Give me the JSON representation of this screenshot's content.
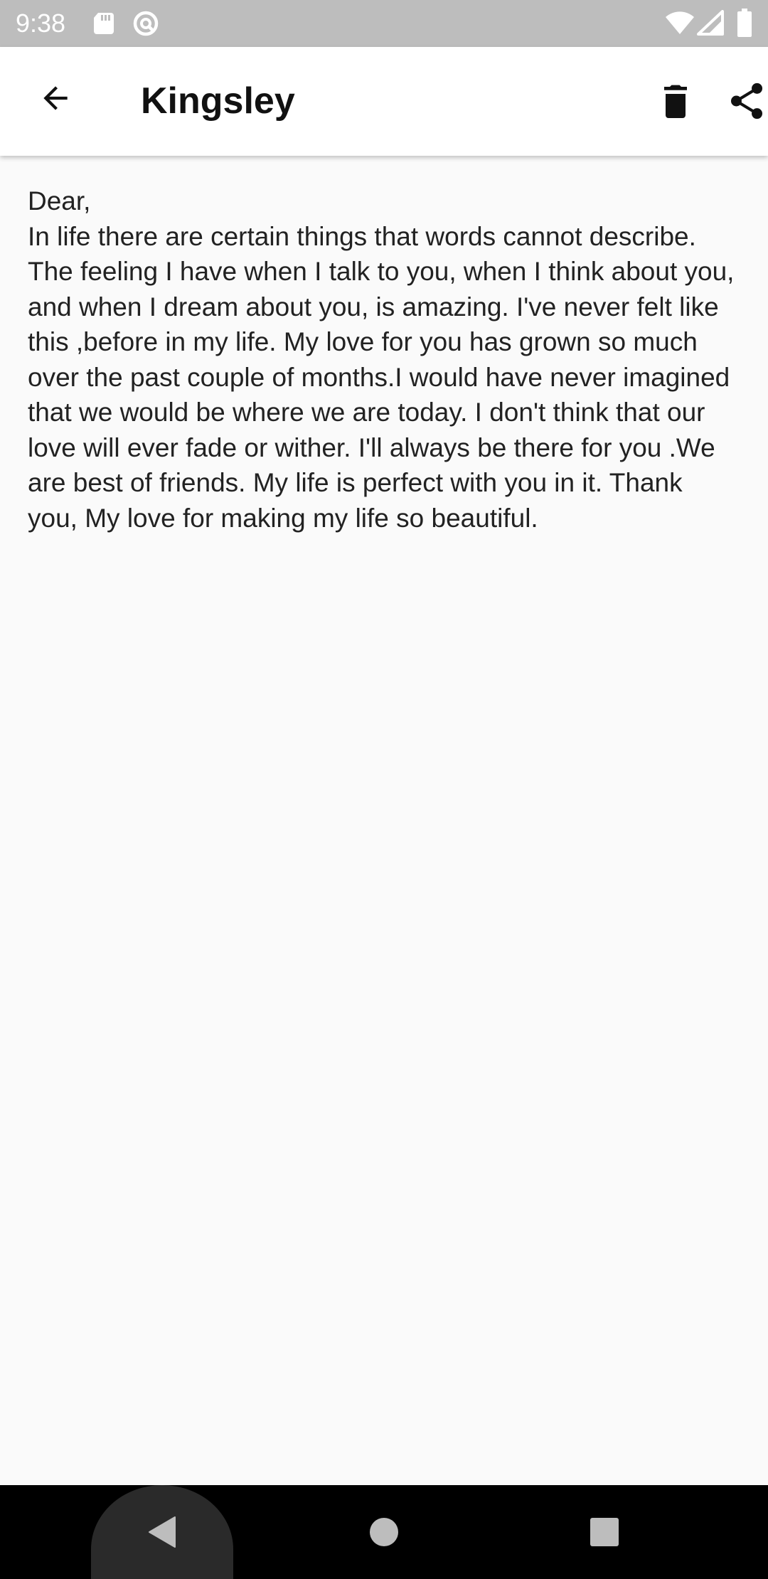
{
  "status_bar": {
    "time": "9:38",
    "icons": [
      "sd-card-icon",
      "sync-icon",
      "wifi-icon",
      "signal-icon",
      "battery-icon"
    ]
  },
  "app_bar": {
    "title": "Kingsley",
    "icons": [
      "back-arrow-icon",
      "trash-icon",
      "share-icon"
    ]
  },
  "note": {
    "greeting": "Dear,",
    "body": "In life there are certain things that words cannot describe. The feeling I have when I talk to you, when I think about you, and when I dream about you, is amazing. I've never felt like this ,before in my life. My love for you has grown so much over the past couple of months.I would have never imagined that we would be where we are today. I don't think that our love will ever fade or wither. I'll always be there for you .We are best of friends. My life is perfect with you in it. Thank you, My love for making my life so beautiful."
  },
  "nav_bar": {
    "icons": [
      "nav-back-icon",
      "nav-home-icon",
      "nav-recents-icon"
    ]
  },
  "colors": {
    "status_bar": "#bdbdbd",
    "app_bar": "#ffffff",
    "background": "#fafafa",
    "text": "#222222",
    "nav_bar": "#000000"
  }
}
